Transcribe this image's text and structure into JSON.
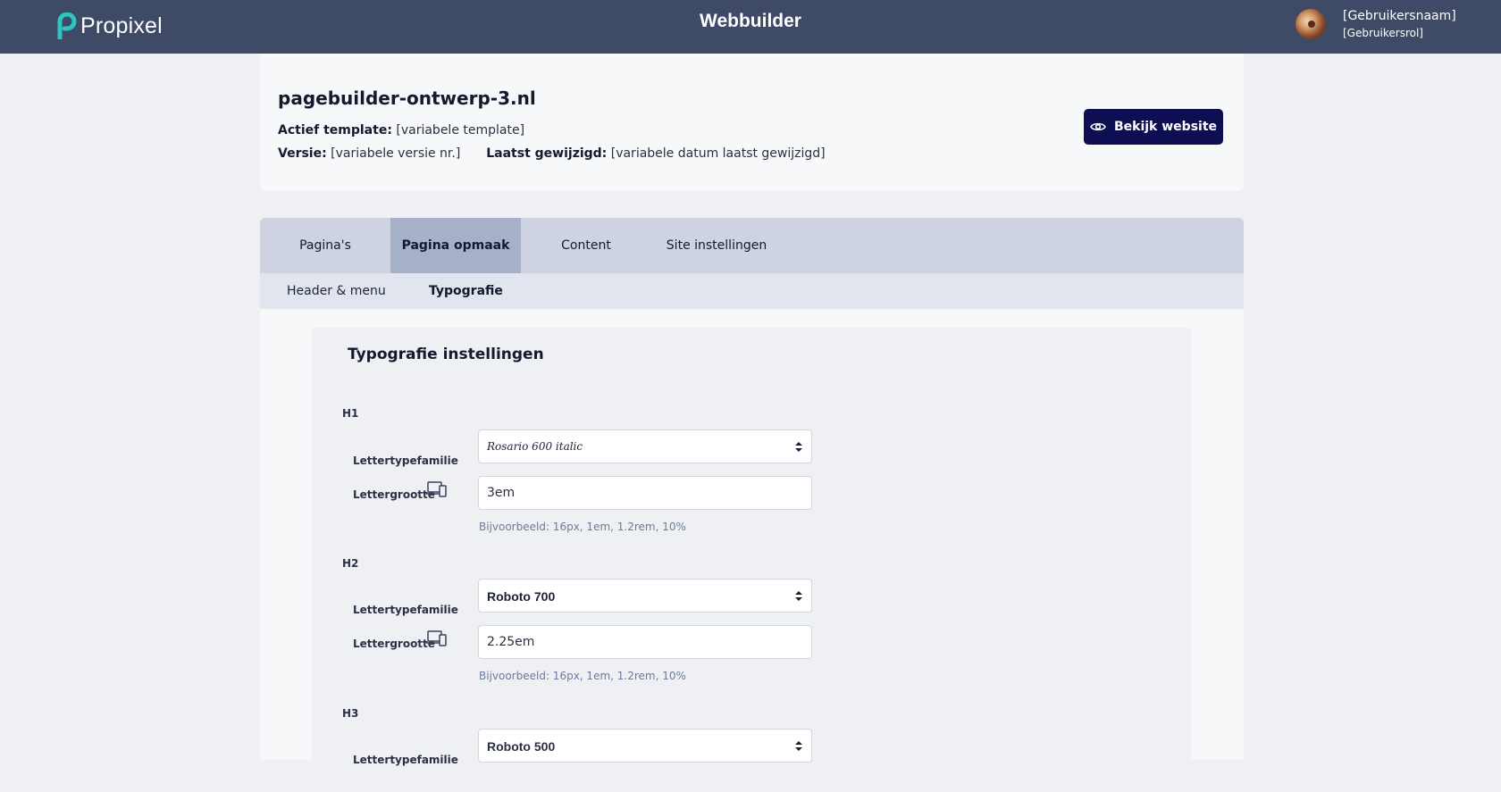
{
  "topbar": {
    "logo_text": "Propixel",
    "app_title": "Webbuilder",
    "user_name": "[Gebruikersnaam]",
    "user_role": "[Gebruikersrol]",
    "background": "#3e4a66",
    "logo_accent": "#2ec4c0"
  },
  "site": {
    "name": "pagebuilder-ontwerp-3.nl",
    "template_label": "Actief template:",
    "template_value": "[variabele template]",
    "version_label": "Versie:",
    "version_value": "[variabele versie nr.]",
    "modified_label": "Laatst gewijzigd:",
    "modified_value": "[variabele datum laatst gewijzigd]",
    "view_button": "Bekijk website",
    "view_button_icon": "eye-icon",
    "button_color": "#0d0f52"
  },
  "tabs": [
    {
      "label": "Pagina's",
      "active": false
    },
    {
      "label": "Pagina opmaak",
      "active": true
    },
    {
      "label": "Content",
      "active": false
    },
    {
      "label": "Site instellingen",
      "active": false
    }
  ],
  "subtabs": [
    {
      "label": "Header & menu",
      "active": false
    },
    {
      "label": "Typografie",
      "active": true
    }
  ],
  "panel": {
    "title": "Typografie instellingen",
    "font_family_label": "Lettertypefamilie",
    "font_size_label": "Lettergrootte",
    "device_icon": "devices-icon",
    "hint": "Bijvoorbeeld: 16px, 1em, 1.2rem, 10%",
    "headings": [
      {
        "label": "H1",
        "font": "Rosario 600 italic",
        "size": "3em"
      },
      {
        "label": "H2",
        "font": "Roboto 700",
        "size": "2.25em"
      },
      {
        "label": "H3",
        "font": "Roboto 500",
        "size": ""
      }
    ]
  }
}
